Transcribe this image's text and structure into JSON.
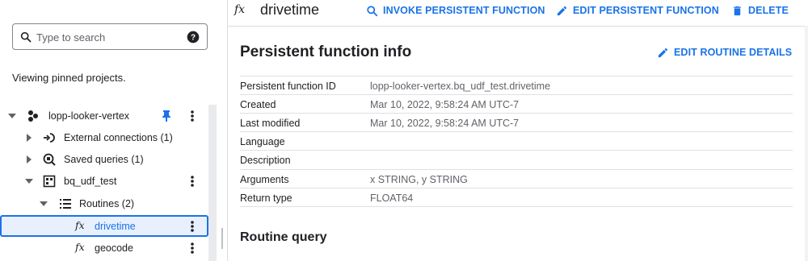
{
  "search": {
    "placeholder": "Type to search"
  },
  "explorer": {
    "pinned_text": "Viewing pinned projects.",
    "tree": [
      {
        "label": "lopp-looker-vertex",
        "icon": "project-icon",
        "expanded": true,
        "pinned": true
      },
      {
        "label": "External connections (1)",
        "icon": "external-connection-icon",
        "expanded": false
      },
      {
        "label": "Saved queries (1)",
        "icon": "saved-query-icon",
        "expanded": false
      },
      {
        "label": "bq_udf_test",
        "icon": "dataset-icon",
        "expanded": true
      },
      {
        "label": "Routines (2)",
        "icon": "routines-icon",
        "expanded": true
      },
      {
        "label": "drivetime",
        "icon": "function-icon",
        "selected": true
      },
      {
        "label": "geocode",
        "icon": "function-icon"
      }
    ]
  },
  "toolbar": {
    "title": "drivetime",
    "invoke_label": "INVOKE PERSISTENT FUNCTION",
    "edit_label": "EDIT PERSISTENT FUNCTION",
    "delete_label": "DELETE"
  },
  "details": {
    "section_title": "Persistent function info",
    "edit_details_label": "EDIT ROUTINE DETAILS",
    "rows": [
      {
        "key": "Persistent function ID",
        "value": "lopp-looker-vertex.bq_udf_test.drivetime"
      },
      {
        "key": "Created",
        "value": "Mar 10, 2022, 9:58:24 AM UTC-7"
      },
      {
        "key": "Last modified",
        "value": "Mar 10, 2022, 9:58:24 AM UTC-7"
      },
      {
        "key": "Language",
        "value": ""
      },
      {
        "key": "Description",
        "value": ""
      },
      {
        "key": "Arguments",
        "value": "x STRING, y STRING"
      },
      {
        "key": "Return type",
        "value": "FLOAT64"
      }
    ],
    "query_title": "Routine query"
  },
  "colors": {
    "accent": "#1a73e8",
    "text": "#202124",
    "muted": "#5f6368",
    "selected_bg": "#e8f0fe"
  }
}
